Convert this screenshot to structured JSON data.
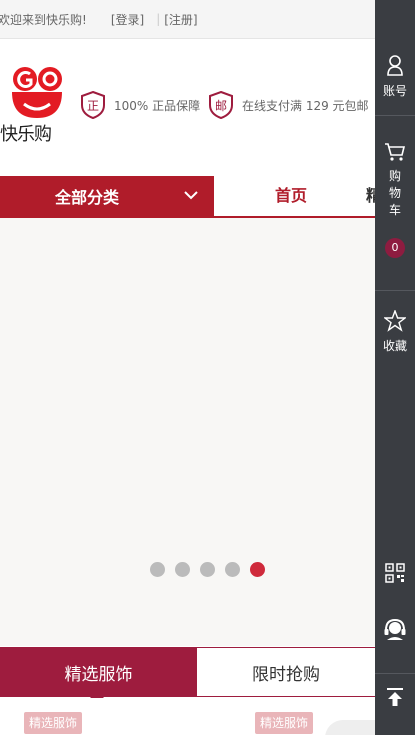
{
  "topbar": {
    "welcome": "欢迎来到快乐购!",
    "login": "[登录]",
    "separator": "|",
    "register": "[注册]"
  },
  "header": {
    "logo_text": "快乐购",
    "badges": [
      {
        "icon_char": "正",
        "text": "100% 正品保障"
      },
      {
        "icon_char": "邮",
        "text": "在线支付满 129 元包邮"
      }
    ]
  },
  "nav": {
    "all_categories": "全部分类",
    "items": [
      "首页",
      "精"
    ]
  },
  "banner": {
    "slide_count": 5,
    "active_slide": 5
  },
  "tabs": {
    "tab1": "精选服饰",
    "tab2": "限时抢购"
  },
  "cards": {
    "tags": [
      "精选服饰",
      "精选服饰"
    ]
  },
  "sidebar": {
    "account_label": "账号",
    "cart_label": [
      "购",
      "物",
      "车"
    ],
    "cart_count": "0",
    "favorites_label": "收藏"
  },
  "colors": {
    "brand_red": "#b01c2a",
    "tab_red": "#9e1c3e",
    "sidebar_bg": "#3a3d42"
  }
}
